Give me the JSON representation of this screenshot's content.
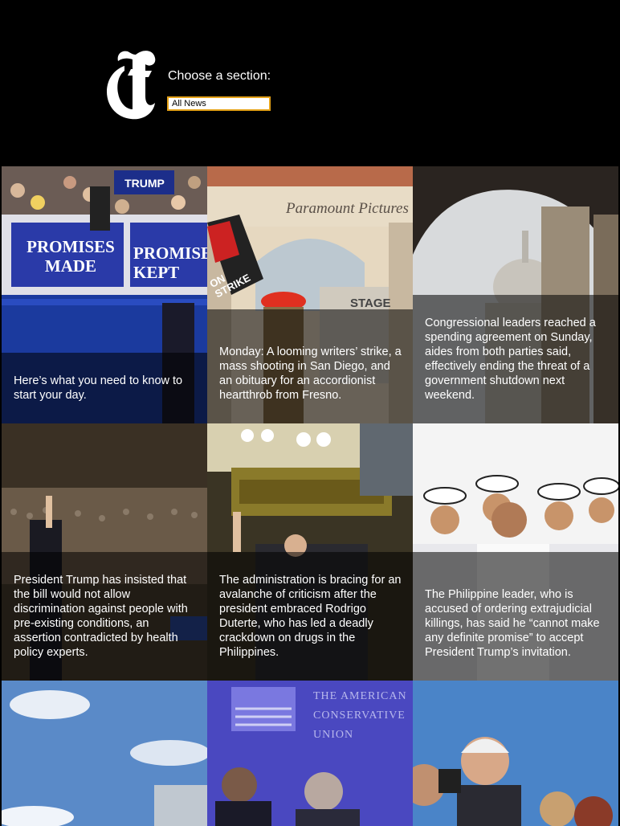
{
  "header": {
    "section_label": "Choose a section:",
    "section_value": "All News"
  },
  "tiles": [
    {
      "caption": "Here’s what you need to know to start your day.",
      "sign_left": "PROMISES MADE",
      "sign_right": "PROMISES KEPT",
      "banner": "TRUMP"
    },
    {
      "caption": "Monday: A looming writers’ strike, a mass shooting in San Diego, and an obituary for an accordionist heartthrob from Fresno.",
      "gate_sign": "Paramount Pictures",
      "picket": "ON STRIKE",
      "stage": "STAGE"
    },
    {
      "caption": "Congressional leaders reached a spending agreement on Sunday, aides from both parties said, effectively ending the threat of a government shutdown next weekend."
    },
    {
      "caption": "President Trump has insisted that the bill would not allow discrimination against people with pre-existing conditions, an assertion contradicted by health policy experts."
    },
    {
      "caption": "The administration is bracing for an avalanche of criticism after the president embraced Rodrigo Duterte, who has led a deadly crackdown on drugs in the Philippines."
    },
    {
      "caption": "The Philippine leader, who is accused of ordering extrajudicial killings, has said he “cannot make any definite promise” to accept President Trump’s invitation."
    },
    {
      "caption": ""
    },
    {
      "caption": "",
      "banner": "THE AMERICAN CONSERVATIVE UNION"
    },
    {
      "caption": ""
    }
  ]
}
